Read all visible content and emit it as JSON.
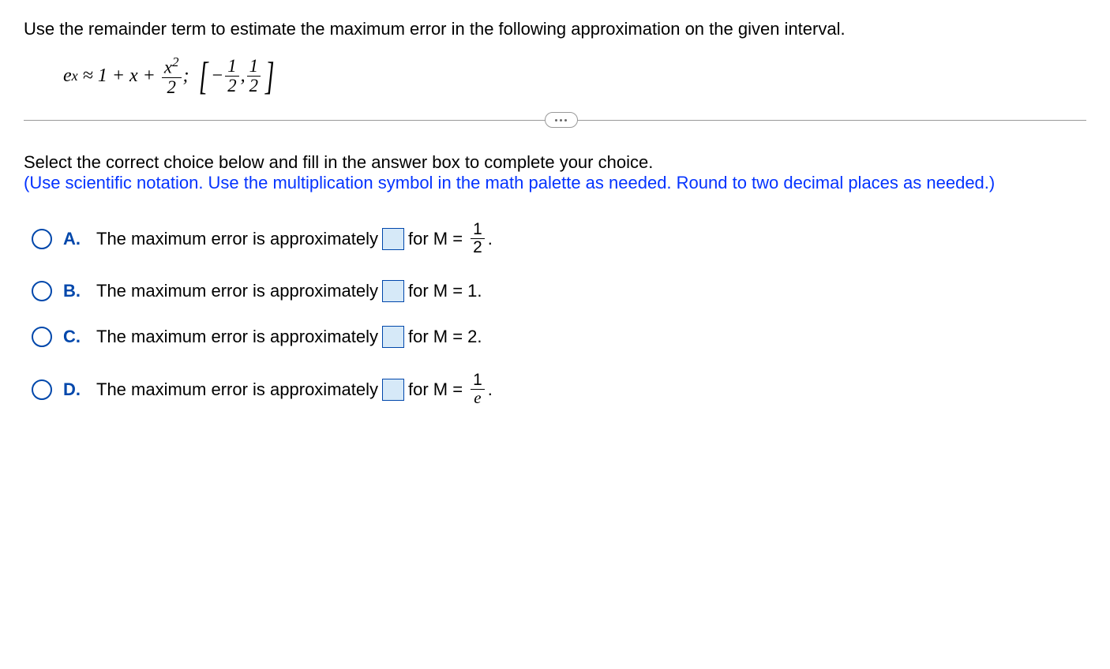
{
  "question": "Use the remainder term to estimate the maximum error in the following approximation on the given interval.",
  "formula": {
    "lhs_base": "e",
    "lhs_exp": "x",
    "approx": "≈",
    "rhs_start": "1 + x +",
    "frac_num": "x",
    "frac_num_exp": "2",
    "frac_den": "2",
    "semicolon": ";",
    "interval": {
      "neg": "−",
      "a_num": "1",
      "a_den": "2",
      "comma": ",",
      "b_num": "1",
      "b_den": "2"
    }
  },
  "instructions": {
    "line1": "Select the correct choice below and fill in the answer box to complete your choice.",
    "line2": "(Use scientific notation. Use the multiplication symbol in the math palette as needed. Round to two decimal places as needed.)"
  },
  "choices": {
    "a": {
      "label": "A.",
      "text_before": "The maximum error is approximately",
      "text_after1": "for M =",
      "frac_num": "1",
      "frac_den": "2",
      "period": "."
    },
    "b": {
      "label": "B.",
      "text_before": "The maximum error is approximately",
      "text_after": "for M = 1."
    },
    "c": {
      "label": "C.",
      "text_before": "The maximum error is approximately",
      "text_after": "for M = 2."
    },
    "d": {
      "label": "D.",
      "text_before": "The maximum error is approximately",
      "text_after1": "for M =",
      "frac_num": "1",
      "frac_den": "e",
      "period": "."
    }
  }
}
